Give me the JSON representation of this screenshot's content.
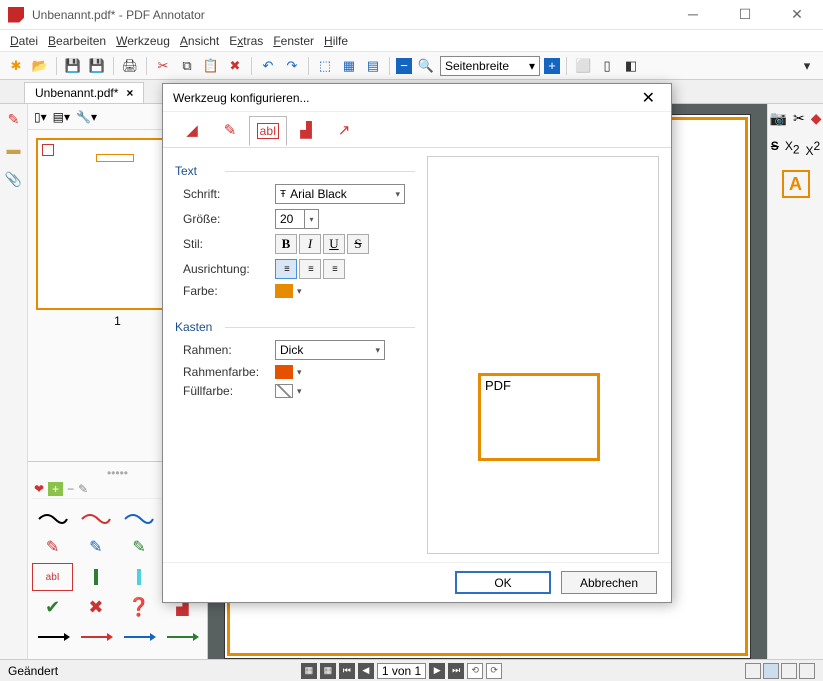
{
  "window": {
    "title": "Unbenannt.pdf* - PDF Annotator"
  },
  "menu": {
    "items": [
      "Datei",
      "Bearbeiten",
      "Werkzeug",
      "Ansicht",
      "Extras",
      "Fenster",
      "Hilfe"
    ]
  },
  "toolbar": {
    "zoom_label": "Seitenbreite"
  },
  "doctab": {
    "name": "Unbenannt.pdf*"
  },
  "thumb": {
    "page_num": "1"
  },
  "status": {
    "left": "Geändert",
    "page_field": "1 von 1"
  },
  "dialog": {
    "title": "Werkzeug konfigurieren...",
    "section_text": "Text",
    "section_box": "Kasten",
    "labels": {
      "font": "Schrift:",
      "size": "Größe:",
      "style": "Stil:",
      "align": "Ausrichtung:",
      "color": "Farbe:",
      "border": "Rahmen:",
      "border_color": "Rahmenfarbe:",
      "fill_color": "Füllfarbe:"
    },
    "values": {
      "font": "Arial Black",
      "size": "20",
      "border": "Dick",
      "text_color": "#e68a00",
      "border_color_hex": "#e65100",
      "fill_none": true
    },
    "preview_text": "PDF",
    "buttons": {
      "ok": "OK",
      "cancel": "Abbrechen"
    }
  },
  "right_tools": {
    "sub_super": [
      "S",
      "X₂",
      "X²"
    ]
  }
}
